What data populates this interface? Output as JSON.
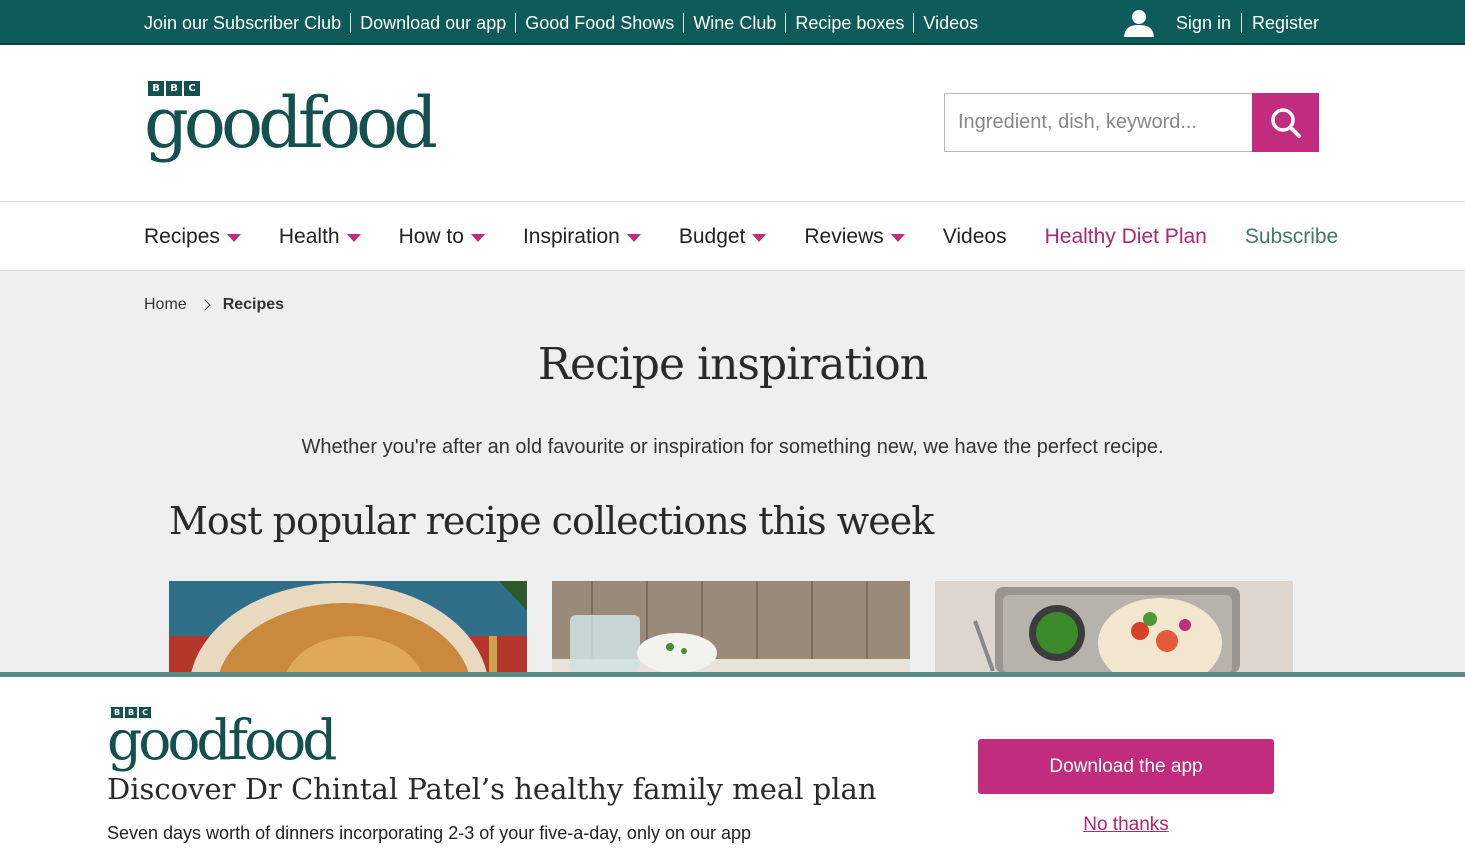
{
  "topbar": {
    "links": [
      "Join our Subscriber Club",
      "Download our app",
      "Good Food Shows",
      "Wine Club",
      "Recipe boxes",
      "Videos"
    ],
    "sign_in": "Sign in",
    "register": "Register"
  },
  "header": {
    "logo_bbc": [
      "B",
      "B",
      "C"
    ],
    "logo_text": "goodfood",
    "search_placeholder": "Ingredient, dish, keyword..."
  },
  "nav": {
    "items": [
      "Recipes",
      "Health",
      "How to",
      "Inspiration",
      "Budget",
      "Reviews",
      "Videos",
      "Healthy Diet Plan",
      "Subscribe"
    ]
  },
  "breadcrumb": {
    "home": "Home",
    "current": "Recipes"
  },
  "page": {
    "title": "Recipe inspiration",
    "intro": "Whether you're after an old favourite or inspiration for something new, we have the perfect recipe.",
    "section_title": "Most popular recipe collections this week"
  },
  "banner": {
    "logo_text": "goodfood",
    "title": "Discover Dr Chintal Patel’s healthy family meal plan",
    "subtitle": "Seven days worth of dinners incorporating 2-3 of your five-a-day, only on our app",
    "download_button": "Download the app",
    "dismiss_link": "No thanks"
  },
  "colors": {
    "topbar": "#0e5c5a",
    "brand_green": "#14504e",
    "accent_pink": "#c22c7f"
  }
}
